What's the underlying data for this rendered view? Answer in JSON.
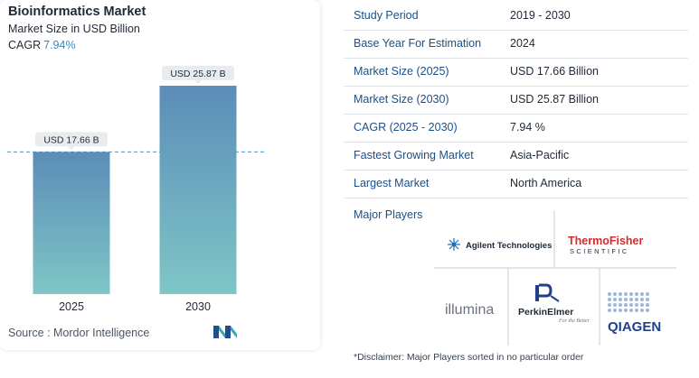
{
  "chart_data": {
    "type": "bar",
    "title": "Bioinformatics Market",
    "subtitle": "Market Size in USD Billion",
    "cagr_label": "CAGR",
    "cagr_value": "7.94%",
    "categories": [
      "2025",
      "2030"
    ],
    "values": [
      17.66,
      25.87
    ],
    "data_labels": [
      "USD 17.66 B",
      "USD 25.87 B"
    ],
    "ylim": [
      0,
      28
    ],
    "grid": false,
    "reference_line": "dashed at 2025 value",
    "colors": {
      "bar_top": "#5b8db8",
      "bar_bottom": "#7fc6c6",
      "label_bg": "#e9ecef",
      "reference": "#4a90c0"
    }
  },
  "source": "Source :  Mordor Intelligence",
  "info_table": [
    {
      "label": "Study Period",
      "value": "2019 - 2030"
    },
    {
      "label": "Base Year For Estimation",
      "value": "2024"
    },
    {
      "label": "Market Size (2025)",
      "value": "USD 17.66 Billion"
    },
    {
      "label": "Market Size (2030)",
      "value": "USD 25.87 Billion"
    },
    {
      "label": "CAGR (2025 - 2030)",
      "value": "7.94 %"
    },
    {
      "label": "Fastest Growing Market",
      "value": "Asia-Pacific"
    },
    {
      "label": "Largest Market",
      "value": "North America"
    }
  ],
  "major_players_label": "Major Players",
  "players": {
    "agilent": "Agilent Technologies",
    "thermo_line1": "ThermoFisher",
    "thermo_line2": "SCIENTIFIC",
    "illumina": "illumina",
    "perkin": "PerkinElmer",
    "perkin_tag": "For the Better",
    "qiagen": "QIAGEN"
  },
  "disclaimer": "*Disclaimer: Major Players sorted in no particular order"
}
